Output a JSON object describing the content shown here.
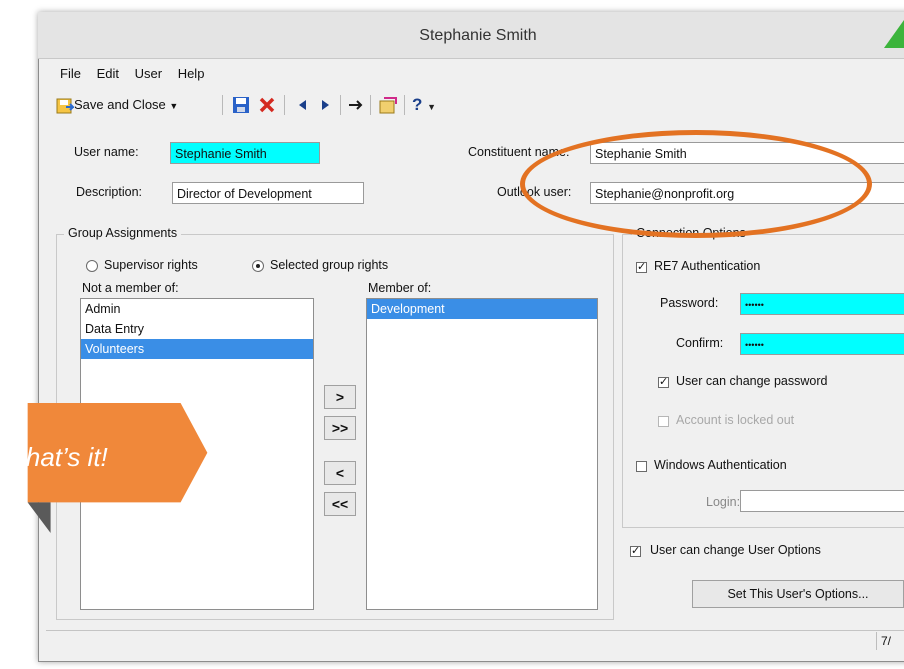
{
  "window": {
    "title": "Stephanie Smith"
  },
  "menu": [
    {
      "label": "File"
    },
    {
      "label": "Edit"
    },
    {
      "label": "User"
    },
    {
      "label": "Help"
    }
  ],
  "toolbar": {
    "save_close_label": "Save and Close",
    "help_label": "?"
  },
  "form": {
    "user_name_label": "User name:",
    "user_name_value": "Stephanie Smith",
    "description_label": "Description:",
    "description_value": "Director of Development",
    "constituent_label": "Constituent name:",
    "constituent_value": "Stephanie Smith",
    "outlook_label": "Outlook user:",
    "outlook_value": "Stephanie@nonprofit.org"
  },
  "group_assignments": {
    "legend": "Group Assignments",
    "supervisor_label": "Supervisor rights",
    "selected_label": "Selected group rights",
    "selected_option": "Selected group rights",
    "not_member_label": "Not a member of:",
    "member_label": "Member of:",
    "not_member_items": [
      {
        "label": "Admin",
        "selected": false
      },
      {
        "label": "Data Entry",
        "selected": false
      },
      {
        "label": "Volunteers",
        "selected": true
      }
    ],
    "member_items": [
      {
        "label": "Development",
        "selected": true
      }
    ],
    "add_label": ">",
    "add_all_label": ">>",
    "remove_label": "<",
    "remove_all_label": "<<"
  },
  "connection": {
    "legend": "Connection Options",
    "re7_label": "RE7 Authentication",
    "re7_checked": true,
    "password_label": "Password:",
    "password_value": "••••••",
    "confirm_label": "Confirm:",
    "confirm_value": "••••••",
    "can_change_pw_label": "User can change password",
    "can_change_pw_checked": true,
    "locked_label": "Account is locked out",
    "locked_checked": false,
    "windows_label": "Windows Authentication",
    "windows_checked": false,
    "login_label": "Login:",
    "login_value": ""
  },
  "user_options": {
    "label": "User can change User Options",
    "checked": true,
    "button_label": "Set This User's Options..."
  },
  "status": {
    "page": "7/"
  },
  "callout": {
    "text": "That’s it!",
    "color": "#f0883a",
    "text_color": "#ffffff"
  },
  "highlight": {
    "color": "#e37222"
  }
}
